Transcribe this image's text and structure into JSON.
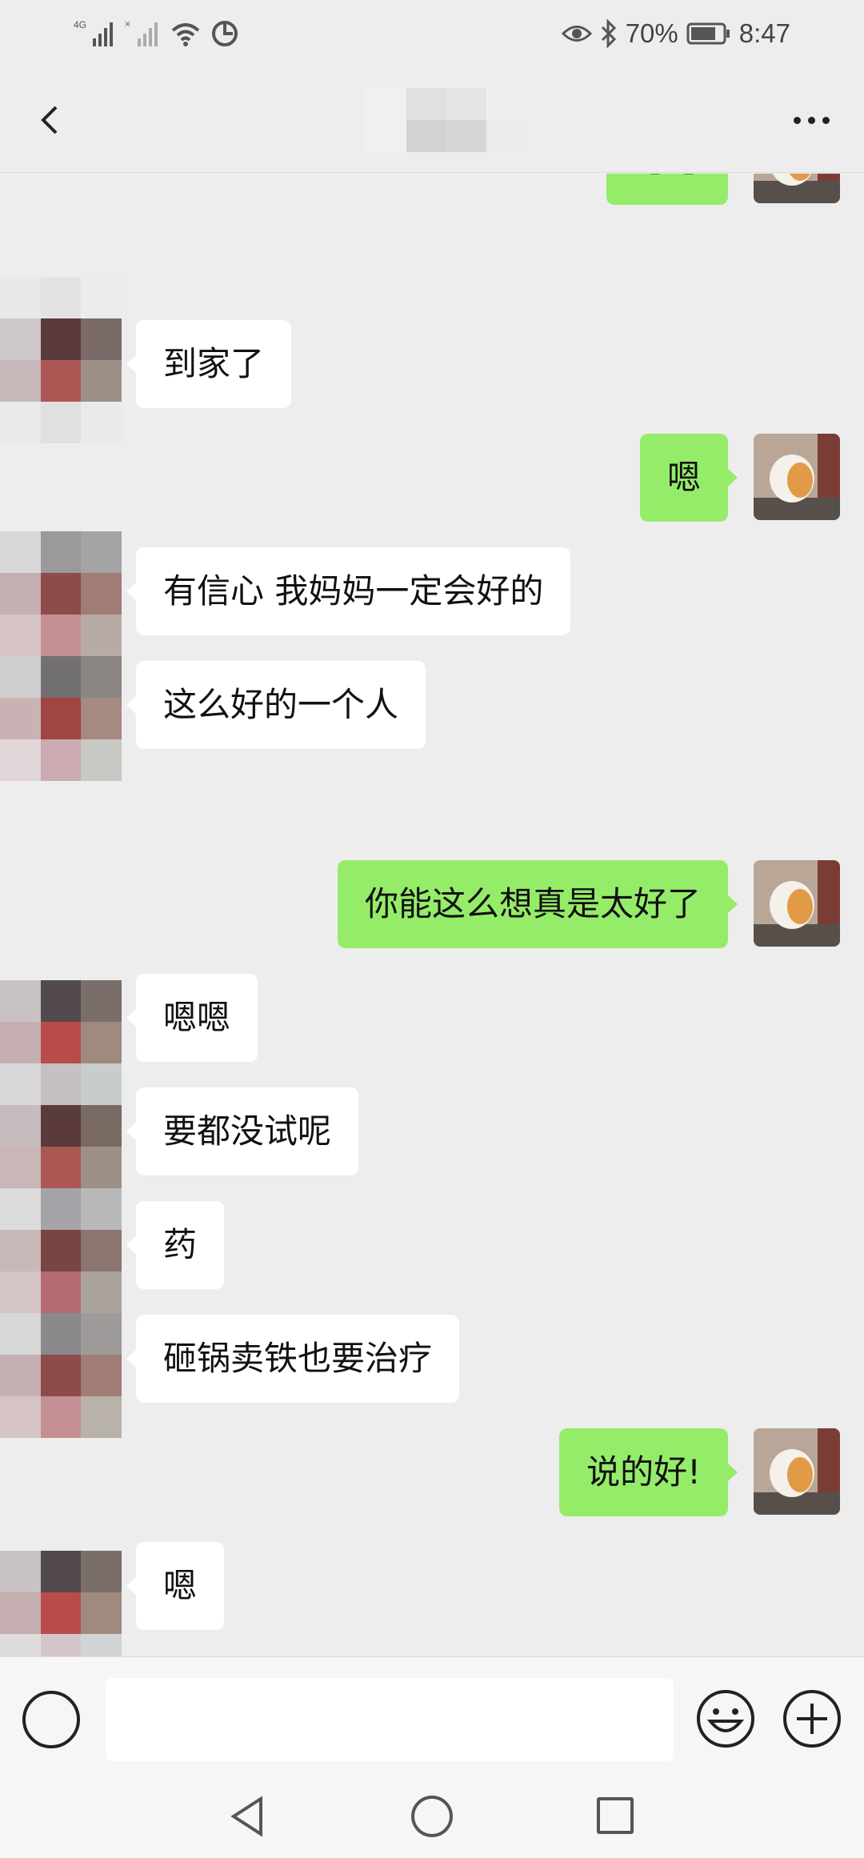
{
  "status_bar": {
    "network": "4G",
    "battery": "70%",
    "time": "8:47"
  },
  "header": {
    "title": ""
  },
  "messages": [
    {
      "side": "out",
      "text": "嗯嗯",
      "partial": true
    },
    {
      "side": "in",
      "text": "到家了"
    },
    {
      "side": "out",
      "text": "嗯"
    },
    {
      "side": "in",
      "text": "有信心 我妈妈一定会好的"
    },
    {
      "side": "in",
      "text": "这么好的一个人"
    },
    {
      "side": "out",
      "text": "你能这么想真是太好了"
    },
    {
      "side": "in",
      "text": "嗯嗯"
    },
    {
      "side": "in",
      "text": "要都没试呢"
    },
    {
      "side": "in",
      "text": "药"
    },
    {
      "side": "in",
      "text": "砸锅卖铁也要治疗"
    },
    {
      "side": "out",
      "text": "说的好!"
    },
    {
      "side": "in",
      "text": "嗯"
    }
  ],
  "input": {
    "value": "",
    "placeholder": ""
  },
  "icons": {
    "back": "chevron-left-icon",
    "more": "more-dots-icon",
    "voice": "voice-icon",
    "emoji": "emoji-icon",
    "plus": "plus-icon"
  },
  "colors": {
    "background": "#ededed",
    "outgoing_bubble": "#95ec69",
    "incoming_bubble": "#ffffff"
  }
}
